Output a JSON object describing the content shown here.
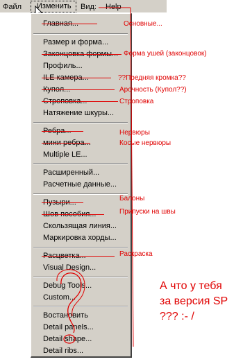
{
  "menubar": {
    "file": "Файл",
    "edit": "Изменить",
    "view": "Вид:",
    "help": "Help"
  },
  "menu": [
    "Главная...",
    "Размер и форма...",
    "Законцовка формы...",
    "Профиль...",
    "ILE камера...",
    "Купол...",
    "Строповка...",
    "Натяжение шкуры...",
    "Ребра...",
    "мини ребра...",
    "Multiple LE...",
    "Расширенный...",
    "Расчетные данные...",
    "Пузыри...",
    "Шов пособия...",
    "Скользящая линия...",
    "Маркировка хорды...",
    "Расцветка...",
    "Visual Design...",
    "Debug Tools...",
    "Custom...",
    "Востановить",
    "Detail panels...",
    "Detail shape...",
    "Detail ribs..."
  ],
  "notes": {
    "n1": "Основные...",
    "n2": "Форма ушей (законцовок)",
    "n3": "??Предняя кромка??",
    "n4": "Арочность (Купол??)",
    "n5": "Строповка",
    "n6": "Нервюры",
    "n7": "Косые нервюры",
    "n8": "Балоны",
    "n9": "Припуски на швы",
    "n10": "Раскраска"
  },
  "comment": {
    "line1": "А что у тебя",
    "line2": "за версия SP",
    "line3": "??? :- /"
  },
  "colors": {
    "annotation": "#e00000",
    "menu_bg": "#d4d0c8"
  }
}
